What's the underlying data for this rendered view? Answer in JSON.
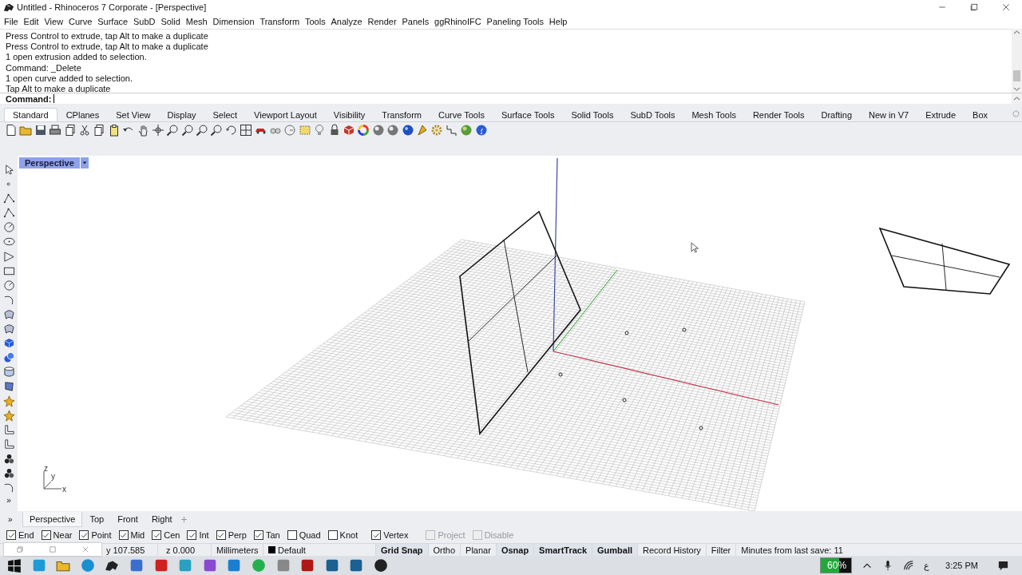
{
  "window": {
    "title": "Untitled - Rhinoceros 7 Corporate - [Perspective]"
  },
  "menu": [
    "File",
    "Edit",
    "View",
    "Curve",
    "Surface",
    "SubD",
    "Solid",
    "Mesh",
    "Dimension",
    "Transform",
    "Tools",
    "Analyze",
    "Render",
    "Panels",
    "ggRhinoIFC",
    "Paneling Tools",
    "Help"
  ],
  "command_history": [
    "Press Control to extrude, tap Alt to make a duplicate",
    "Press Control to extrude, tap Alt to make a duplicate",
    "1 open extrusion added to selection.",
    "Command: _Delete",
    "1 open curve added to selection.",
    "Tap Alt to make a duplicate"
  ],
  "command_prompt": "Command:",
  "toolbar_tabs": [
    {
      "label": "Standard",
      "selected": true
    },
    {
      "label": "CPlanes",
      "selected": false
    },
    {
      "label": "Set View",
      "selected": false
    },
    {
      "label": "Display",
      "selected": false
    },
    {
      "label": "Select",
      "selected": false
    },
    {
      "label": "Viewport Layout",
      "selected": false
    },
    {
      "label": "Visibility",
      "selected": false
    },
    {
      "label": "Transform",
      "selected": false
    },
    {
      "label": "Curve Tools",
      "selected": false
    },
    {
      "label": "Surface Tools",
      "selected": false
    },
    {
      "label": "Solid Tools",
      "selected": false
    },
    {
      "label": "SubD Tools",
      "selected": false
    },
    {
      "label": "Mesh Tools",
      "selected": false
    },
    {
      "label": "Render Tools",
      "selected": false
    },
    {
      "label": "Drafting",
      "selected": false
    },
    {
      "label": "New in V7",
      "selected": false
    },
    {
      "label": "Extrude",
      "selected": false
    },
    {
      "label": "Box",
      "selected": false
    }
  ],
  "viewport": {
    "title": "Perspective",
    "axis_labels": [
      "z",
      "y",
      "x"
    ]
  },
  "left_toolbar_more": "»",
  "viewport_tabs_more": "»",
  "viewport_tabs": [
    {
      "label": "Perspective",
      "selected": true
    },
    {
      "label": "Top",
      "selected": false
    },
    {
      "label": "Front",
      "selected": false
    },
    {
      "label": "Right",
      "selected": false
    }
  ],
  "osnaps": [
    {
      "label": "End",
      "checked": true,
      "disabled": false
    },
    {
      "label": "Near",
      "checked": true,
      "disabled": false
    },
    {
      "label": "Point",
      "checked": true,
      "disabled": false
    },
    {
      "label": "Mid",
      "checked": true,
      "disabled": false
    },
    {
      "label": "Cen",
      "checked": true,
      "disabled": false
    },
    {
      "label": "Int",
      "checked": true,
      "disabled": false
    },
    {
      "label": "Perp",
      "checked": true,
      "disabled": false
    },
    {
      "label": "Tan",
      "checked": true,
      "disabled": false
    },
    {
      "label": "Quad",
      "checked": false,
      "disabled": false
    },
    {
      "label": "Knot",
      "checked": false,
      "disabled": false
    },
    {
      "label": "Vertex",
      "checked": true,
      "disabled": false
    },
    {
      "label": "Project",
      "checked": false,
      "disabled": true
    },
    {
      "label": "Disable",
      "checked": false,
      "disabled": true
    }
  ],
  "status_bar": {
    "coordinates": [
      "y 107.585",
      "z 0.000"
    ],
    "units": "Millimeters",
    "layer": {
      "name": "Default",
      "color": "#000000"
    },
    "toggles": [
      {
        "label": "Grid Snap",
        "on": true
      },
      {
        "label": "Ortho",
        "on": false
      },
      {
        "label": "Planar",
        "on": false
      },
      {
        "label": "Osnap",
        "on": true
      },
      {
        "label": "SmartTrack",
        "on": true
      },
      {
        "label": "Gumball",
        "on": true
      },
      {
        "label": "Record History",
        "on": false
      },
      {
        "label": "Filter",
        "on": false
      }
    ],
    "save_info": "Minutes from last save: 11"
  },
  "taskbar": {
    "battery": {
      "text": "60%",
      "level": 0.6
    },
    "language": "ع",
    "time": "3:25 PM"
  }
}
